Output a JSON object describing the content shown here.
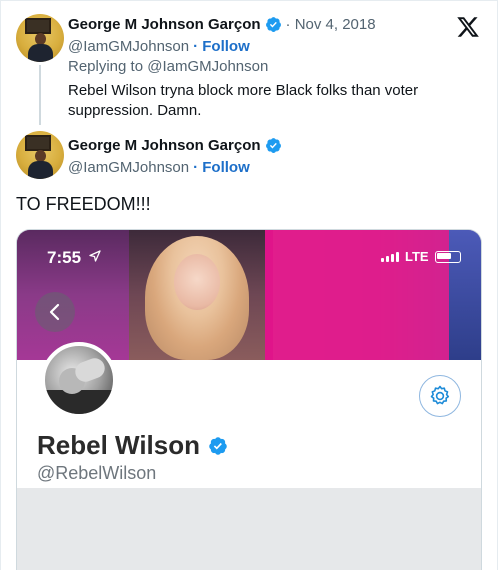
{
  "reply_tweet": {
    "author_name": "George M Johnson Garçon",
    "date": "· Nov 4, 2018",
    "handle": "@IamGMJohnson",
    "follow_label": "· Follow",
    "replying_to": "Replying to @IamGMJohnson",
    "text": "Rebel Wilson tryna block more Black folks than voter suppression. Damn."
  },
  "main_tweet": {
    "author_name": "George M Johnson Garçon",
    "handle": "@IamGMJohnson",
    "follow_label": "· Follow",
    "text": "TO FREEDOM!!!"
  },
  "screenshot": {
    "status_time": "7:55",
    "network": "LTE",
    "profile_name": "Rebel Wilson",
    "profile_handle": "@RebelWilson"
  },
  "icons": {
    "brand": "x-logo-icon",
    "verified": "verified-badge-icon",
    "back": "chevron-left-icon",
    "settings": "gear-icon",
    "location": "location-arrow-icon"
  },
  "colors": {
    "link": "#1d6fc9",
    "verified": "#1d9bf0",
    "muted": "#536471"
  }
}
